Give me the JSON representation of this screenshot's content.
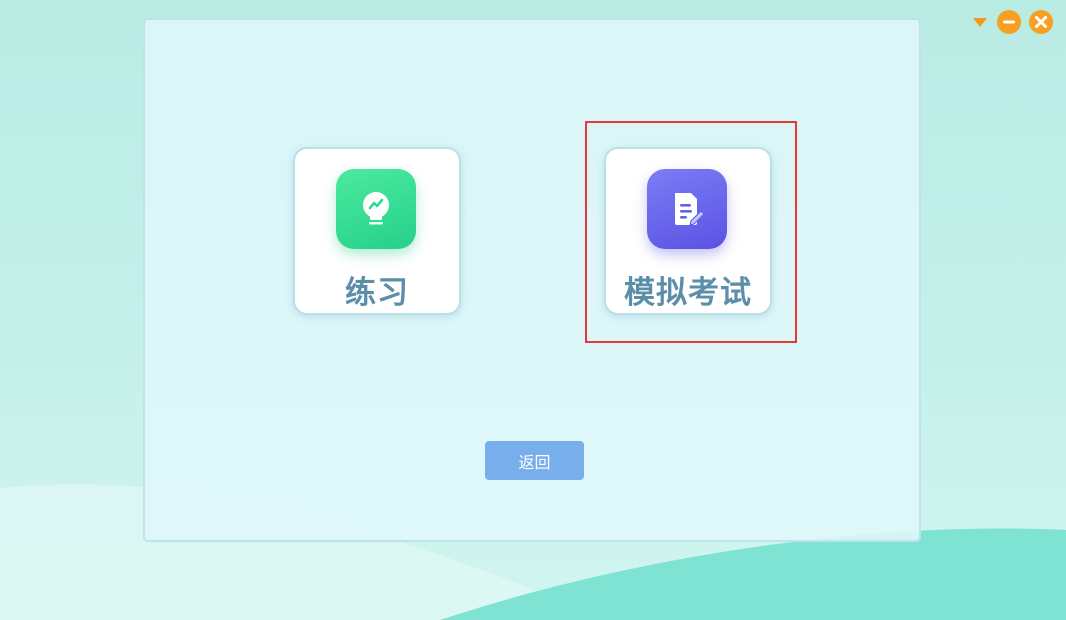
{
  "modes": [
    {
      "label": "练习",
      "icon": "lightbulb-icon",
      "color": "#2fd98f"
    },
    {
      "label": "模拟考试",
      "icon": "document-edit-icon",
      "color": "#6461eb"
    }
  ],
  "back_button": {
    "label": "返回"
  },
  "window_controls": [
    "dropdown-arrow-icon",
    "minimize-icon",
    "close-icon"
  ],
  "colors": {
    "background": "#bfeee6",
    "panel": "#e0f7fa",
    "accent_orange": "#f7a023",
    "button_blue": "#78aeec",
    "label_text": "#5b8ea8",
    "highlight_red": "#e53935"
  }
}
